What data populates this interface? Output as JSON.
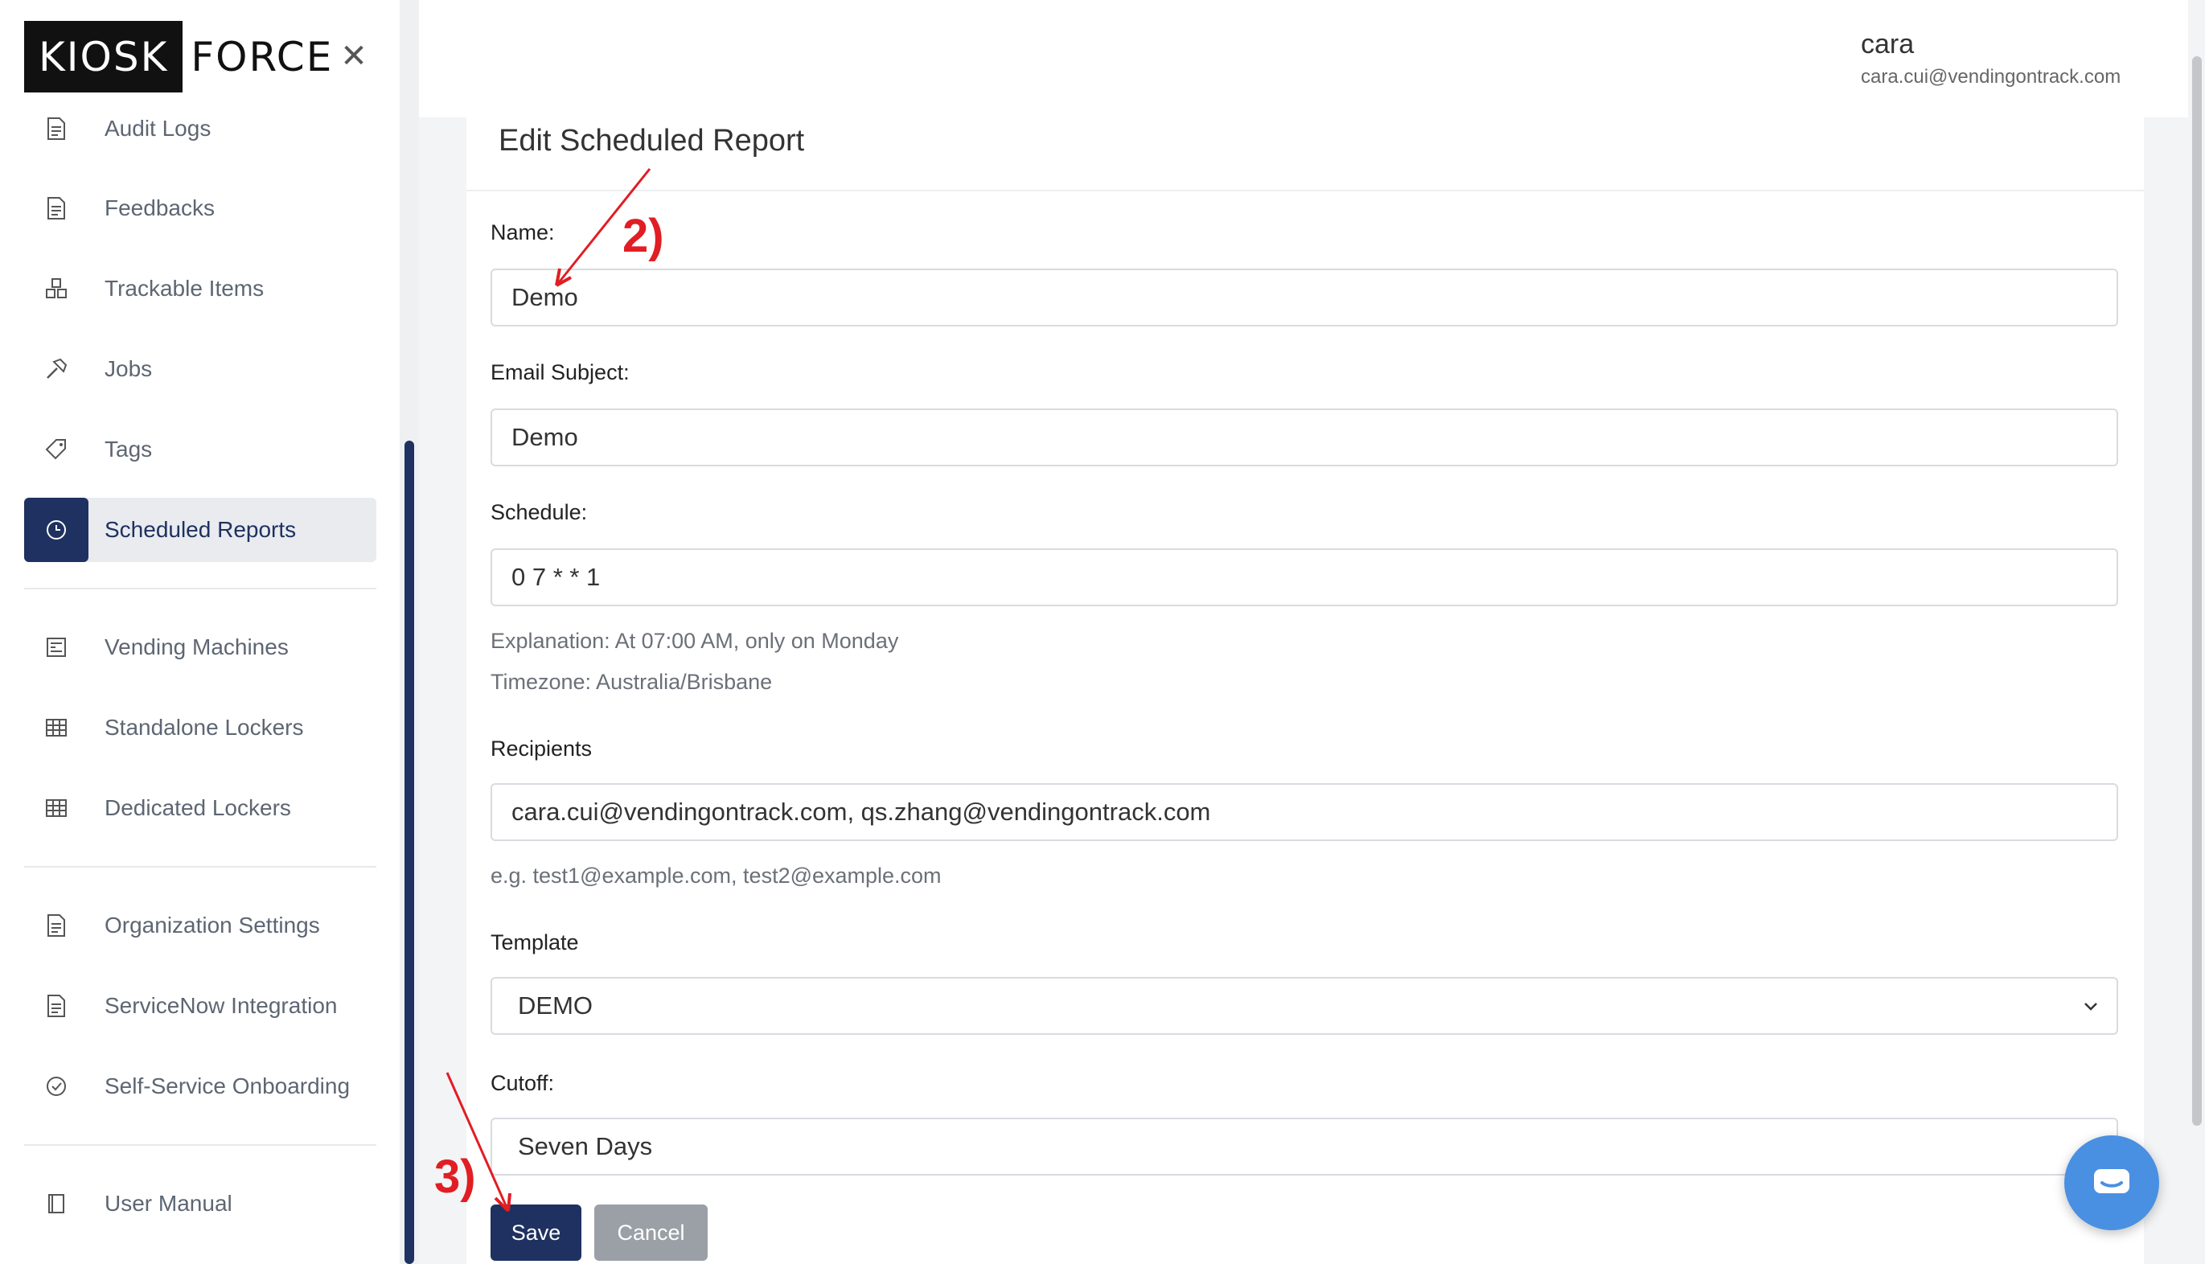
{
  "brand": {
    "logo_left": "KIOSK",
    "logo_right": "FORCE"
  },
  "sidebar": {
    "items": [
      {
        "label": "Audit Logs",
        "icon": "document-icon"
      },
      {
        "label": "Feedbacks",
        "icon": "document-icon"
      },
      {
        "label": "Trackable Items",
        "icon": "boxes-icon"
      },
      {
        "label": "Jobs",
        "icon": "hammer-icon"
      },
      {
        "label": "Tags",
        "icon": "tag-icon"
      },
      {
        "label": "Scheduled Reports",
        "icon": "clock-icon",
        "active": true
      },
      {
        "label": "Vending Machines",
        "icon": "machine-icon"
      },
      {
        "label": "Standalone Lockers",
        "icon": "grid-icon"
      },
      {
        "label": "Dedicated Lockers",
        "icon": "grid-icon"
      },
      {
        "label": "Organization Settings",
        "icon": "document-icon"
      },
      {
        "label": "ServiceNow Integration",
        "icon": "document-icon"
      },
      {
        "label": "Self-Service Onboarding",
        "icon": "check-circle-icon"
      },
      {
        "label": "User Manual",
        "icon": "book-icon"
      }
    ]
  },
  "header": {
    "user_name": "cara",
    "user_email": "cara.cui@vendingontrack.com"
  },
  "form": {
    "title": "Edit Scheduled Report",
    "name_label": "Name:",
    "name_value": "Demo",
    "subject_label": "Email Subject:",
    "subject_value": "Demo",
    "schedule_label": "Schedule:",
    "schedule_value": "0 7 * * 1",
    "explanation": "Explanation: At 07:00 AM, only on Monday",
    "timezone": "Timezone: Australia/Brisbane",
    "recipients_label": "Recipients",
    "recipients_value": "cara.cui@vendingontrack.com, qs.zhang@vendingontrack.com",
    "recipients_hint": "e.g. test1@example.com, test2@example.com",
    "template_label": "Template",
    "template_value": "DEMO",
    "cutoff_label": "Cutoff:",
    "cutoff_value": "Seven Days",
    "save_label": "Save",
    "cancel_label": "Cancel"
  },
  "annotations": {
    "step2": "2)",
    "step3": "3)",
    "color": "#e01e24"
  }
}
